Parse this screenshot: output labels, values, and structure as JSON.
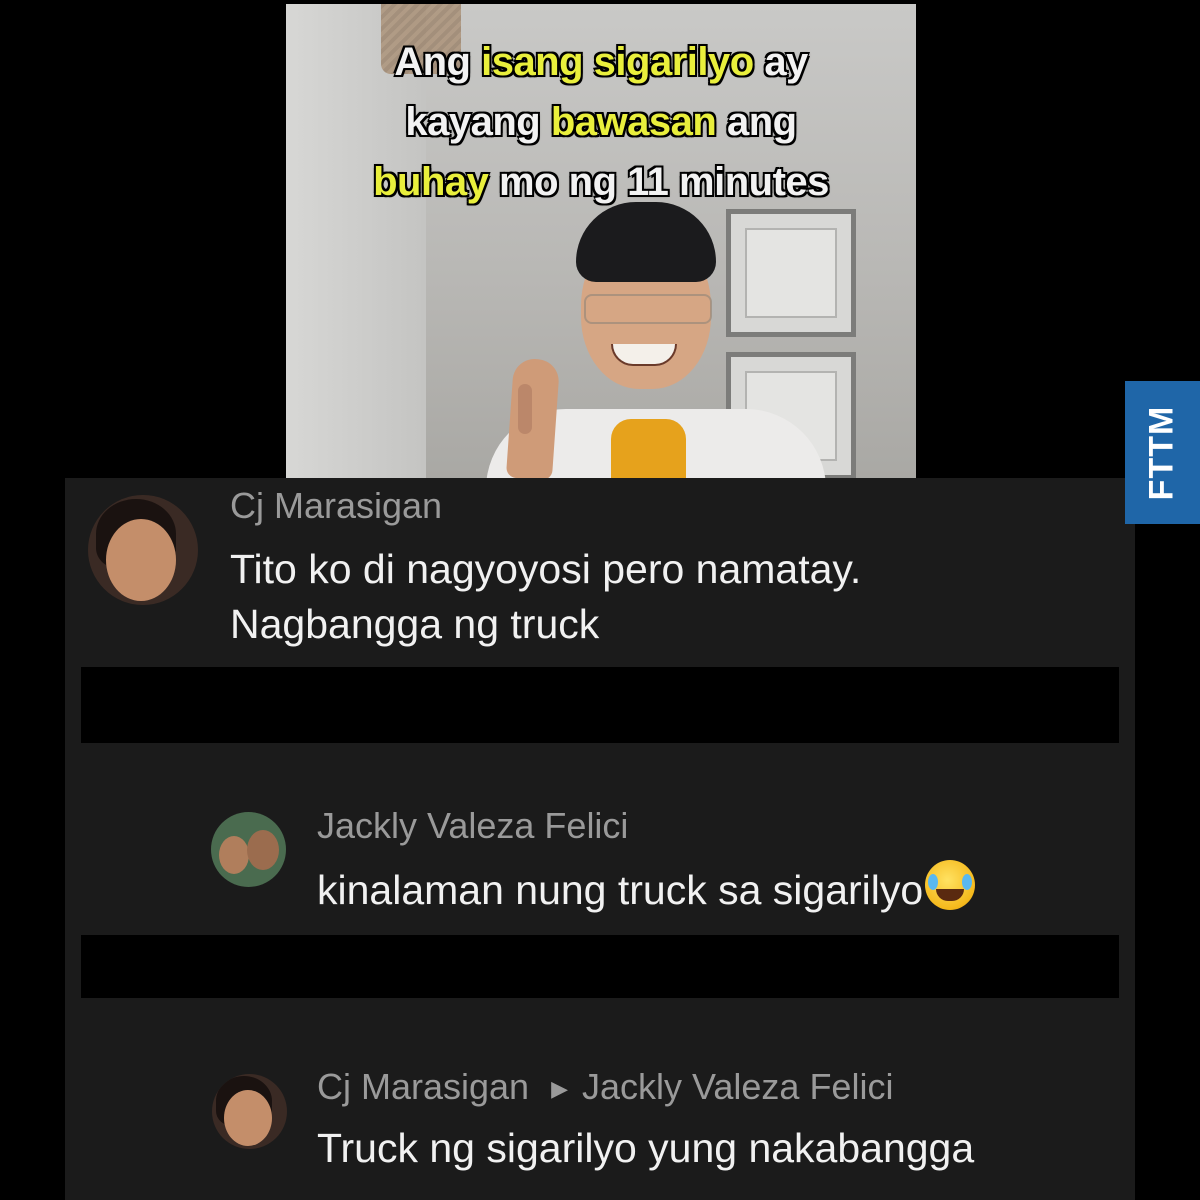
{
  "video": {
    "headline": {
      "l1": [
        "Ang",
        "isang sigarilyo",
        "ay"
      ],
      "l2": [
        "kayang",
        "bawasan",
        "ang"
      ],
      "l3": [
        "buhay",
        "mo ng 11 minutes"
      ]
    },
    "highlight_color": "#e9ef3c"
  },
  "comments": [
    {
      "author": "Cj Marasigan",
      "lines": [
        "Tito ko di nagyoyosi pero namatay.",
        "Nagbangga ng truck"
      ]
    },
    {
      "author": "Jackly Valeza Felici",
      "text": "kinalaman nung truck sa sigarilyo",
      "emoji": "face-with-tears-of-joy"
    },
    {
      "author": "Cj Marasigan",
      "reply_to": "Jackly Valeza Felici",
      "text": "Truck ng sigarilyo yung nakabangga"
    }
  ],
  "watermark": {
    "text": "FTTM",
    "color": "#1f66a8"
  }
}
